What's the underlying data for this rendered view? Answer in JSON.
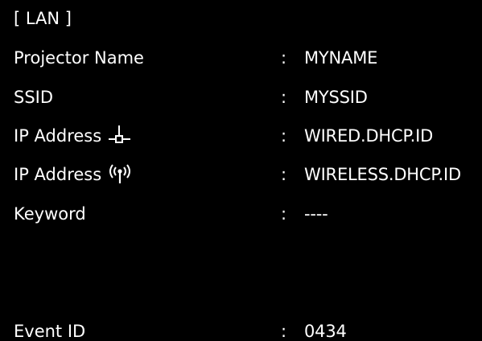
{
  "section_title": "[ LAN ]",
  "rows": [
    {
      "label": "Projector Name",
      "colon": ":",
      "value": "MYNAME"
    },
    {
      "label": "SSID",
      "colon": ":",
      "value": "MYSSID"
    },
    {
      "label": "IP Address",
      "colon": ":",
      "value": "WIRED.DHCP.ID",
      "icon": "wired-lan-icon"
    },
    {
      "label": "IP Address",
      "colon": ":",
      "value": "WIRELESS.DHCP.ID",
      "icon": "wireless-icon"
    },
    {
      "label": "Keyword",
      "colon": ":",
      "value": "----"
    }
  ],
  "event_row": {
    "label": "Event ID",
    "colon": ":",
    "value": "0434"
  },
  "colors": {
    "background": "#000000",
    "text": "#ffffff"
  }
}
